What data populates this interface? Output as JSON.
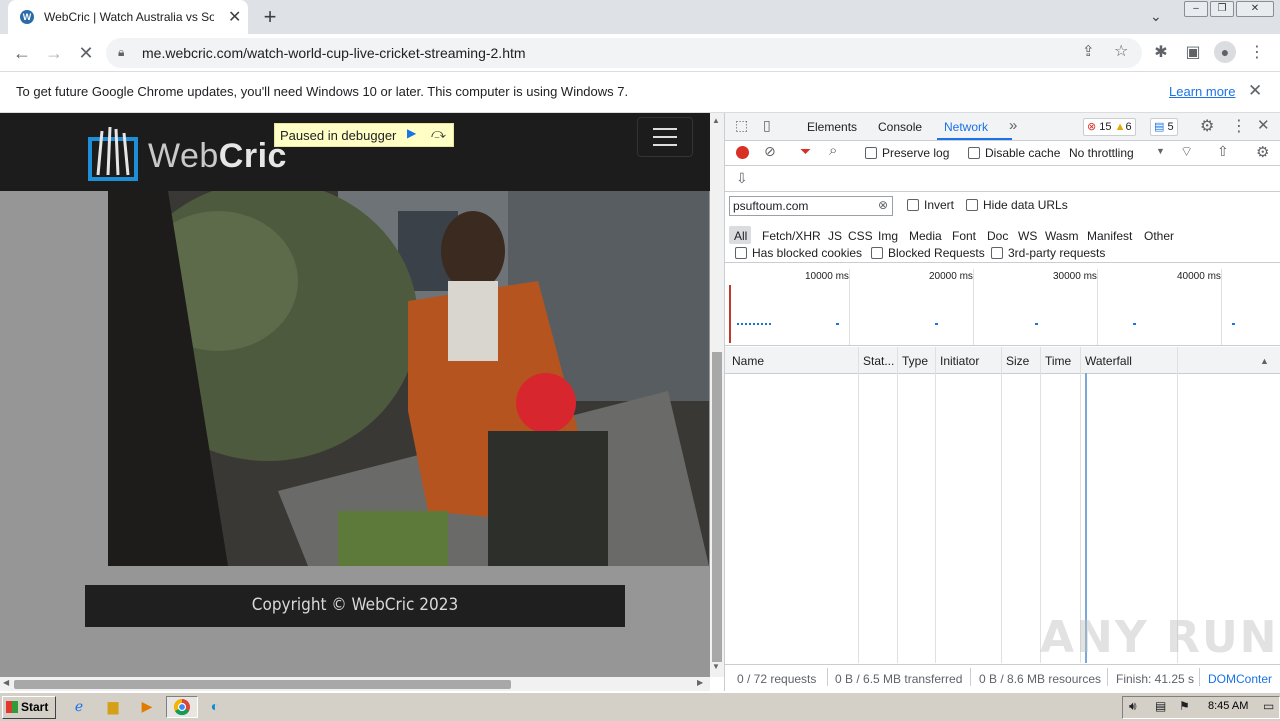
{
  "browser": {
    "tab": {
      "title": "WebCric | Watch Australia vs South",
      "close": "✕"
    },
    "new_tab": "+",
    "url": "me.webcric.com/watch-world-cup-live-cricket-streaming-2.htm",
    "icons": {
      "back": "arrow-left-icon",
      "forward": "arrow-right-icon",
      "stop": "stop-icon",
      "lock": "lock-icon",
      "share": "share-icon",
      "star": "star-icon",
      "extensions": "puzzle-icon",
      "sidepanel": "side-panel-icon",
      "profile": "profile-icon",
      "menu": "kebab-menu-icon"
    }
  },
  "infobar": {
    "message": "To get future Google Chrome updates, you'll need Windows 10 or later. This computer is using Windows 7.",
    "link": "Learn more"
  },
  "page": {
    "logo_web": "Web",
    "logo_cric": "Cric",
    "debugger_text": "Paused in debugger",
    "footer_text": "Copyright © WebCric 2023"
  },
  "devtools": {
    "tabs": [
      "Elements",
      "Console",
      "Network"
    ],
    "active_tab": "Network",
    "more_tabs": "»",
    "errors": "15",
    "warnings": "6",
    "messages": "5",
    "toolbar": {
      "preserve_log": "Preserve log",
      "disable_cache": "Disable cache",
      "throttling": "No throttling"
    },
    "filter": {
      "value": "psuftoum.com",
      "invert": "Invert",
      "hide_data_urls": "Hide data URLs",
      "types": [
        "All",
        "Fetch/XHR",
        "JS",
        "CSS",
        "Img",
        "Media",
        "Font",
        "Doc",
        "WS",
        "Wasm",
        "Manifest",
        "Other"
      ],
      "has_blocked_cookies": "Has blocked cookies",
      "blocked_requests": "Blocked Requests",
      "third_party": "3rd-party requests"
    },
    "timeline_ticks": [
      "10000 ms",
      "20000 ms",
      "30000 ms",
      "40000 ms"
    ],
    "columns": [
      "Name",
      "Stat...",
      "Type",
      "Initiator",
      "Size",
      "Time",
      "Waterfall"
    ],
    "status": {
      "requests": "0 / 72 requests",
      "transferred": "0 B / 6.5 MB transferred",
      "resources": "0 B / 8.6 MB resources",
      "finish": "Finish: 41.25 s",
      "domcontent": "DOMConter"
    }
  },
  "taskbar": {
    "start": "Start",
    "clock": "8:45 AM"
  },
  "watermark": "ANY RUN"
}
